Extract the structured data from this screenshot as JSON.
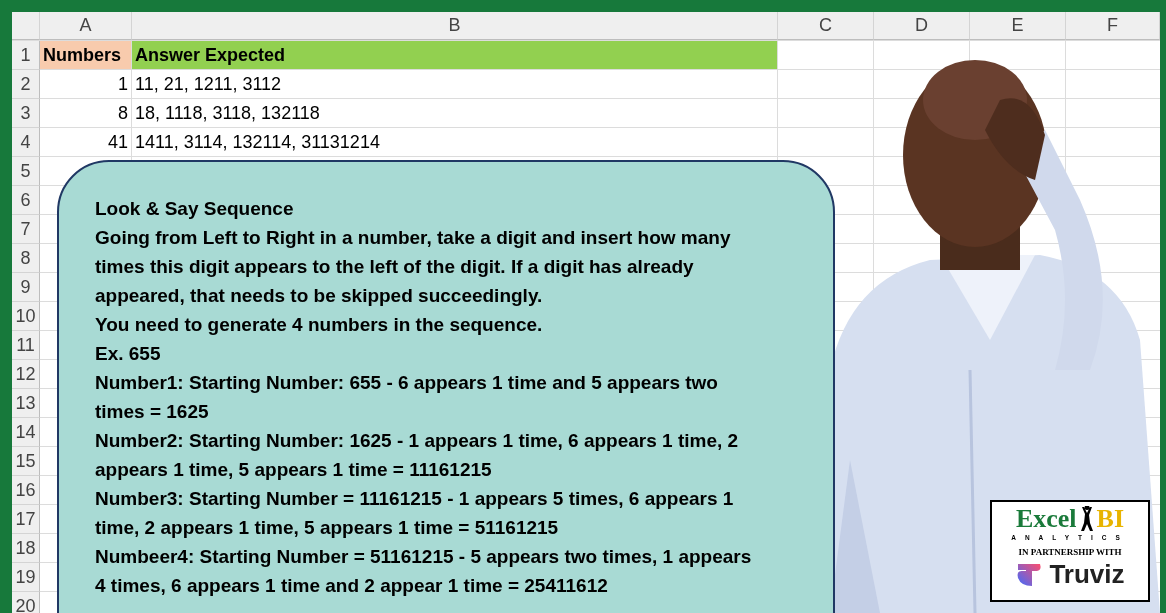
{
  "columns": [
    "A",
    "B",
    "C",
    "D",
    "E",
    "F"
  ],
  "row_numbers": [
    "1",
    "2",
    "3",
    "4",
    "5",
    "6",
    "7",
    "8",
    "9",
    "10",
    "11",
    "12",
    "13",
    "14",
    "15",
    "16",
    "17",
    "18",
    "19",
    "20"
  ],
  "rows": [
    {
      "kind": "header",
      "a": "Numbers",
      "b": "Answer Expected"
    },
    {
      "kind": "data",
      "a": "1",
      "b": "11, 21, 1211, 3112"
    },
    {
      "kind": "data",
      "a": "8",
      "b": "18, 1118, 3118, 132118"
    },
    {
      "kind": "data",
      "a": "41",
      "b": "1411, 3114, 132114, 31131214"
    }
  ],
  "callout": {
    "paragraphs": [
      "Look & Say Sequence",
      "Going from Left to Right in a number, take a digit and insert how many times this digit appears to the left of the digit. If a digit has already appeared, that needs to be skipped succeedingly.",
      "You need to generate 4 numbers in the sequence.",
      "Ex. 655",
      "Number1: Starting Number: 655 - 6 appears 1 time and 5 appears two times = 1625",
      "Number2: Starting Number: 1625 - 1 appears 1 time, 6 appears 1 time, 2 appears 1 time, 5 appears 1 time = 11161215",
      "Number3: Starting Number = 11161215 - 1 appears 5 times, 6 appears 1 time, 2 appears 1 time, 5 appears 1 time = 51161215",
      "Numbeer4: Starting Number = 51161215 - 5 appears two times, 1 appears 4 times, 6 appears 1 time and 2 appear 1 time = 25411612"
    ]
  },
  "logo": {
    "brand_left": "Excel",
    "brand_right": "BI",
    "subtitle": "ANALYTICS",
    "partnership": "IN PARTNERSHIP WITH",
    "partner": "Truviz"
  }
}
